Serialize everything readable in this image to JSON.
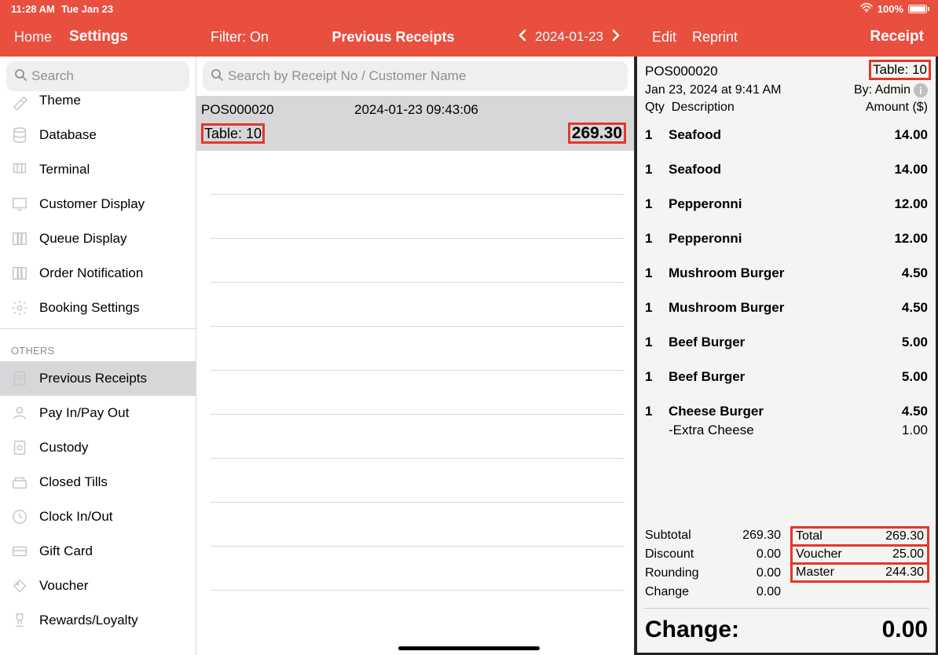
{
  "status": {
    "time": "11:28 AM",
    "date": "Tue Jan 23",
    "battery": "100%"
  },
  "toolbar": {
    "left_home": "Home",
    "left_settings": "Settings",
    "filter": "Filter: On",
    "title": "Previous Receipts",
    "date": "2024-01-23",
    "edit": "Edit",
    "reprint": "Reprint",
    "receipt": "Receipt"
  },
  "sidebar": {
    "search_placeholder": "Search",
    "items_top": [
      {
        "id": "theme",
        "label": "Theme"
      },
      {
        "id": "database",
        "label": "Database"
      },
      {
        "id": "terminal",
        "label": "Terminal"
      },
      {
        "id": "customer-display",
        "label": "Customer Display"
      },
      {
        "id": "queue-display",
        "label": "Queue Display"
      },
      {
        "id": "order-notification",
        "label": "Order Notification"
      },
      {
        "id": "booking-settings",
        "label": "Booking Settings"
      }
    ],
    "others_header": "OTHERS",
    "items_others": [
      {
        "id": "previous-receipts",
        "label": "Previous Receipts",
        "selected": true
      },
      {
        "id": "pay-in-out",
        "label": "Pay In/Pay Out"
      },
      {
        "id": "custody",
        "label": "Custody"
      },
      {
        "id": "closed-tills",
        "label": "Closed Tills"
      },
      {
        "id": "clock-in-out",
        "label": "Clock In/Out"
      },
      {
        "id": "gift-card",
        "label": "Gift Card"
      },
      {
        "id": "voucher",
        "label": "Voucher"
      },
      {
        "id": "rewards",
        "label": "Rewards/Loyalty"
      }
    ]
  },
  "mid": {
    "search_placeholder": "Search by Receipt No / Customer Name",
    "rows": [
      {
        "rno": "POS000020",
        "ts": "2024-01-23 09:43:06",
        "table": "Table: 10",
        "amount": "269.30"
      }
    ]
  },
  "receipt": {
    "no": "POS000020",
    "table": "Table: 10",
    "when": "Jan 23, 2024 at 9:41 AM",
    "by": "By: Admin",
    "col_qty": "Qty",
    "col_desc": "Description",
    "col_amt": "Amount ($)",
    "items": [
      {
        "q": "1",
        "d": "Seafood",
        "a": "14.00"
      },
      {
        "q": "1",
        "d": "Seafood",
        "a": "14.00"
      },
      {
        "q": "1",
        "d": "Pepperonni",
        "a": "12.00"
      },
      {
        "q": "1",
        "d": "Pepperonni",
        "a": "12.00"
      },
      {
        "q": "1",
        "d": "Mushroom Burger",
        "a": "4.50"
      },
      {
        "q": "1",
        "d": "Mushroom Burger",
        "a": "4.50"
      },
      {
        "q": "1",
        "d": "Beef Burger",
        "a": "5.00"
      },
      {
        "q": "1",
        "d": "Beef Burger",
        "a": "5.00"
      },
      {
        "q": "1",
        "d": "Cheese Burger",
        "a": "4.50"
      },
      {
        "q": "",
        "d": "-Extra Cheese",
        "a": "1.00",
        "sub": true
      }
    ],
    "left_totals": [
      {
        "l": "Subtotal",
        "v": "269.30"
      },
      {
        "l": "Discount",
        "v": "0.00"
      },
      {
        "l": "Rounding",
        "v": "0.00"
      },
      {
        "l": "Change",
        "v": "0.00"
      }
    ],
    "right_totals": [
      {
        "l": "Total",
        "v": "269.30"
      },
      {
        "l": "Voucher",
        "v": "25.00"
      },
      {
        "l": "Master",
        "v": "244.30"
      }
    ],
    "change_label": "Change:",
    "change_value": "0.00"
  }
}
